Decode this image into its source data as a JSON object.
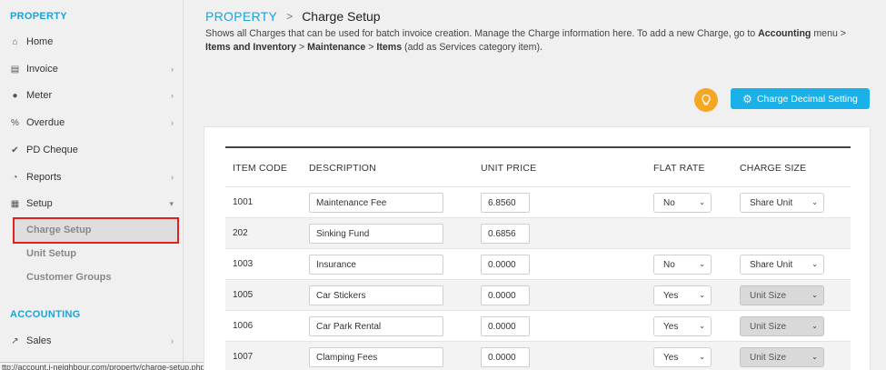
{
  "sidebar": {
    "property_title": "PROPERTY",
    "accounting_title": "ACCOUNTING",
    "items": [
      {
        "label": "Home",
        "icon": "home-icon",
        "glyph": "⌂",
        "arrow": ""
      },
      {
        "label": "Invoice",
        "icon": "document-icon",
        "glyph": "▤",
        "arrow": "›"
      },
      {
        "label": "Meter",
        "icon": "drop-icon",
        "glyph": "●",
        "arrow": "›"
      },
      {
        "label": "Overdue",
        "icon": "percent-icon",
        "glyph": "%",
        "arrow": "›"
      },
      {
        "label": "PD Cheque",
        "icon": "check-icon",
        "glyph": "✔",
        "arrow": ""
      },
      {
        "label": "Reports",
        "icon": "pie-chart-icon",
        "glyph": "◔",
        "arrow": "›"
      },
      {
        "label": "Setup",
        "icon": "grid-icon",
        "glyph": "▦",
        "arrow": "▾"
      }
    ],
    "sub_items": [
      "Charge Setup",
      "Unit Setup",
      "Customer Groups"
    ],
    "accounting_items": [
      {
        "label": "Sales",
        "icon": "line-chart-icon",
        "glyph": "↗",
        "arrow": "›"
      }
    ]
  },
  "status_url": "ttp://account.i-neighbour.com/property/charge-setup.php",
  "breadcrumb": {
    "parent": "PROPERTY",
    "separator": ">",
    "current": "Charge Setup"
  },
  "description": {
    "t1": "Shows all Charges that can be used for batch invoice creation. Manage the Charge information here. To add a new Charge, go to ",
    "b1": "Accounting",
    "t2": " menu > ",
    "b2": "Items and Inventory",
    "t3": " > ",
    "b3": "Maintenance",
    "t4": " > ",
    "b4": "Items",
    "t5": " (add as Services category item)."
  },
  "toolbar": {
    "decimal_button": "Charge Decimal Setting"
  },
  "table": {
    "headers": [
      "ITEM CODE",
      "DESCRIPTION",
      "UNIT PRICE",
      "FLAT RATE",
      "CHARGE SIZE"
    ],
    "rows": [
      {
        "code": "1001",
        "description": "Maintenance Fee",
        "price": "6.8560",
        "flat": "No",
        "size": "Share Unit",
        "size_disabled": false
      },
      {
        "code": "202",
        "description": "Sinking Fund",
        "price": "0.6856",
        "flat": "",
        "size": "",
        "size_disabled": false
      },
      {
        "code": "1003",
        "description": "Insurance",
        "price": "0.0000",
        "flat": "No",
        "size": "Share Unit",
        "size_disabled": false
      },
      {
        "code": "1005",
        "description": "Car Stickers",
        "price": "0.0000",
        "flat": "Yes",
        "size": "Unit Size",
        "size_disabled": true
      },
      {
        "code": "1006",
        "description": "Car Park Rental",
        "price": "0.0000",
        "flat": "Yes",
        "size": "Unit Size",
        "size_disabled": true
      },
      {
        "code": "1007",
        "description": "Clamping Fees",
        "price": "0.0000",
        "flat": "Yes",
        "size": "Unit Size",
        "size_disabled": true
      }
    ]
  },
  "colors": {
    "accent": "#1aa4d8",
    "button": "#1ab1e8",
    "bulb": "#f5a623",
    "highlight_border": "#e2201d"
  }
}
